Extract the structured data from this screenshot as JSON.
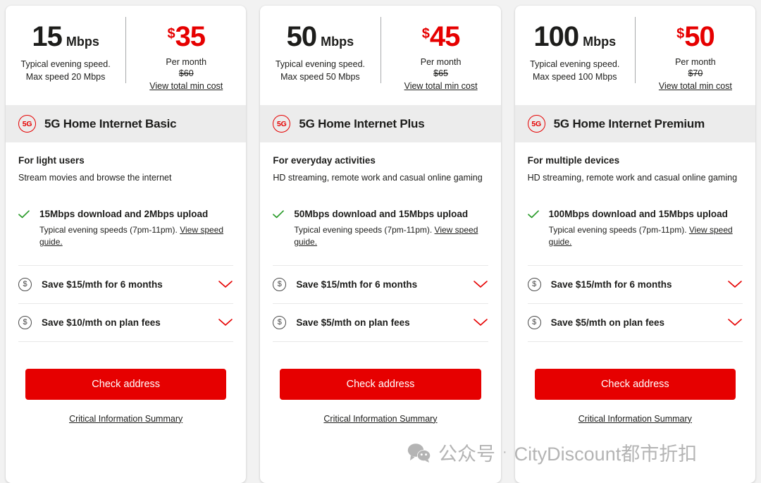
{
  "colors": {
    "brand_red": "#e60000",
    "text_dark": "#1d1d1b",
    "band_grey": "#ececec",
    "page_bg": "#f2f2f2",
    "check_green": "#2a9b2a"
  },
  "common": {
    "speed_note_line1": "Typical evening speed.",
    "per_month_label": "Per month",
    "view_total_min_cost": "View total min cost",
    "badge_5g": "5G",
    "feature_sub_prefix": "Typical evening speeds (7pm-11pm). ",
    "view_speed_guide": "View speed guide.",
    "cta_label": "Check address",
    "cis_label": "Critical Information Summary",
    "currency_symbol": "$",
    "check_icon": "check-icon",
    "dollar_icon": "dollar-circle-icon",
    "chevron_icon": "chevron-down-icon"
  },
  "plans": [
    {
      "speed_number": "15",
      "speed_unit": "Mbps",
      "speed_note_line2": "Max speed 20 Mbps",
      "price_amount": "35",
      "price_was": "$60",
      "name": "5G Home Internet Basic",
      "audience_title": "For light users",
      "audience_desc": "Stream movies and browse the internet",
      "feature_title": "15Mbps download and 2Mbps upload",
      "offers": [
        "Save $15/mth for 6 months",
        "Save $10/mth on plan fees"
      ]
    },
    {
      "speed_number": "50",
      "speed_unit": "Mbps",
      "speed_note_line2": "Max speed 50 Mbps",
      "price_amount": "45",
      "price_was": "$65",
      "name": "5G Home Internet Plus",
      "audience_title": "For everyday activities",
      "audience_desc": "HD streaming, remote work and casual online gaming",
      "feature_title": "50Mbps download and 15Mbps upload",
      "offers": [
        "Save $15/mth for 6 months",
        "Save $5/mth on plan fees"
      ]
    },
    {
      "speed_number": "100",
      "speed_unit": "Mbps",
      "speed_note_line2": "Max speed 100 Mbps",
      "price_amount": "50",
      "price_was": "$70",
      "name": "5G Home Internet Premium",
      "audience_title": "For multiple devices",
      "audience_desc": "HD streaming, remote work and casual online gaming",
      "feature_title": "100Mbps download and 15Mbps upload",
      "offers": [
        "Save $15/mth for 6 months",
        "Save $5/mth on plan fees"
      ]
    }
  ],
  "watermark": {
    "account_label": "公众号",
    "separator": "·",
    "brand": "CityDiscount都市折扣"
  }
}
